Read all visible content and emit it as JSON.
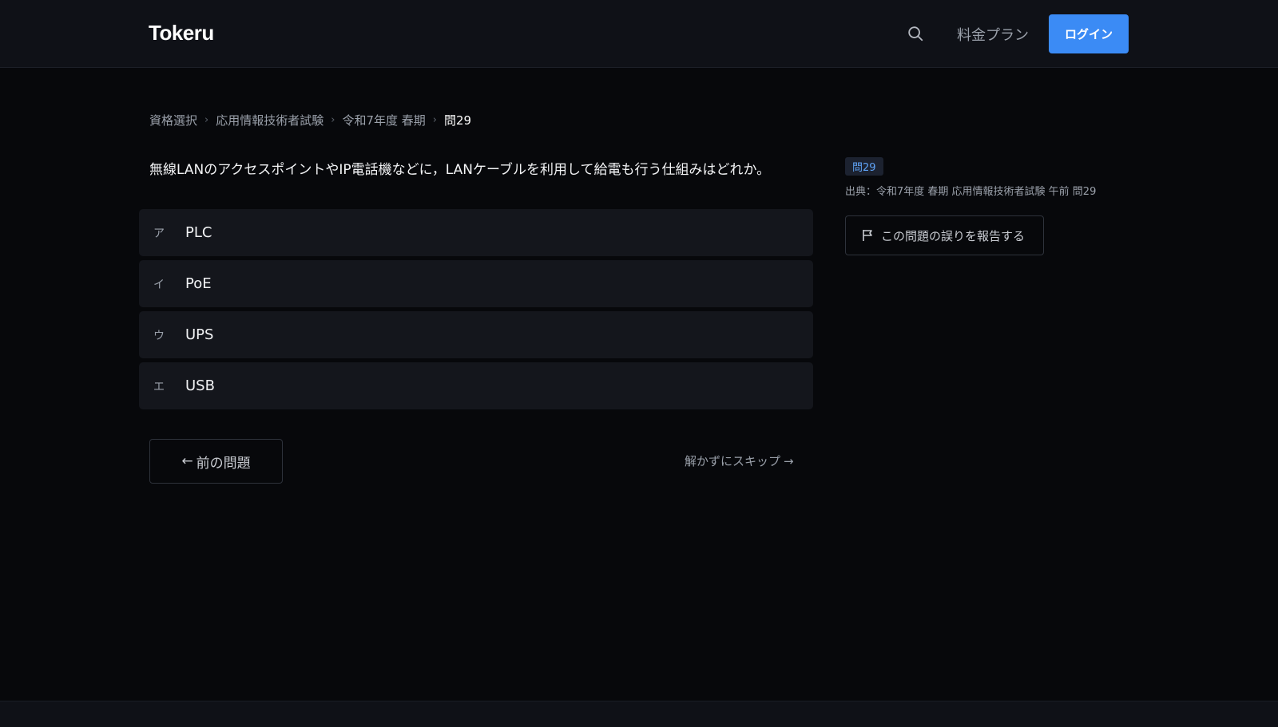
{
  "header": {
    "logo": "Tokeru",
    "pricing_label": "料金プラン",
    "login_label": "ログイン",
    "icons": {
      "search": "search-icon"
    }
  },
  "breadcrumb": {
    "items": [
      "資格選択",
      "応用情報技術者試験",
      "令和7年度 春期"
    ],
    "current": "問29"
  },
  "question": {
    "text": "無線LANのアクセスポイントやIP電話機などに，LANケーブルを利用して給電も行う仕組みはどれか。",
    "choices": [
      {
        "letter": "ア",
        "text": "PLC"
      },
      {
        "letter": "イ",
        "text": "PoE"
      },
      {
        "letter": "ウ",
        "text": "UPS"
      },
      {
        "letter": "エ",
        "text": "USB"
      }
    ]
  },
  "nav": {
    "prev_label": "前の問題",
    "skip_label": "解かずにスキップ"
  },
  "sidebar": {
    "badge": "問29",
    "source": "出典：令和7年度 春期 応用情報技術者試験 午前 問29",
    "report_label": "この問題の誤りを報告する",
    "icons": {
      "report": "flag-icon"
    }
  },
  "colors": {
    "background": "#07080b",
    "header": "#0f1117",
    "accent": "#3b8bf5",
    "badge_text": "#5fa3f6"
  }
}
